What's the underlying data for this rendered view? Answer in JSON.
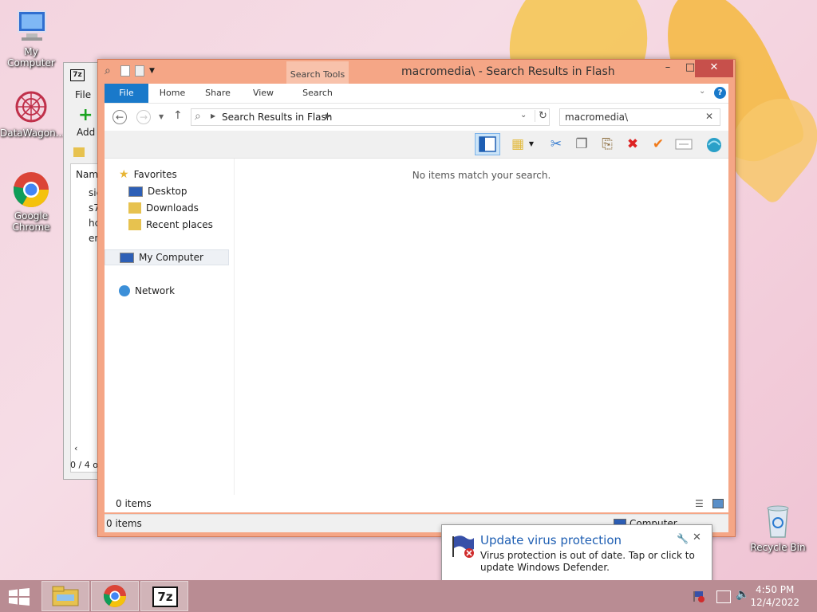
{
  "desktop": {
    "icons": [
      {
        "label": "My Computer"
      },
      {
        "label": "DataWagon..."
      },
      {
        "label": "Google Chrome"
      },
      {
        "label": "Recycle Bin"
      }
    ]
  },
  "bg_window": {
    "file_label": "File",
    "add_label": "Add",
    "col_name": "Name",
    "rows": [
      "sie",
      "s7",
      "hc",
      "en"
    ],
    "status": "0 / 4 o"
  },
  "explorer": {
    "title": "macromedia\\ - Search Results in Flash",
    "contextual_group": "Search Tools",
    "tabs": [
      "File",
      "Home",
      "Share",
      "View",
      "Search"
    ],
    "address_crumb": "Search Results in Flash",
    "search_value": "macromedia\\",
    "nav": {
      "favorites": "Favorites",
      "desktop": "Desktop",
      "downloads": "Downloads",
      "recent": "Recent places",
      "computer": "My Computer",
      "network": "Network"
    },
    "empty_message": "No items match your search.",
    "status_count": "0 items",
    "status_bottom_count": "0 items",
    "status_location": "Computer"
  },
  "notification": {
    "title": "Update virus protection",
    "message": "Virus protection is out of date. Tap or click to update Windows Defender."
  },
  "taskbar": {
    "time": "4:50 PM",
    "date": "12/4/2022",
    "sevenzip_label": "7z"
  },
  "colors": {
    "titlebar": "#f5a686",
    "file_tab": "#1979ca",
    "close_button": "#c7504b",
    "taskbar": "#b98c93",
    "toast_title": "#1f5fb3"
  }
}
